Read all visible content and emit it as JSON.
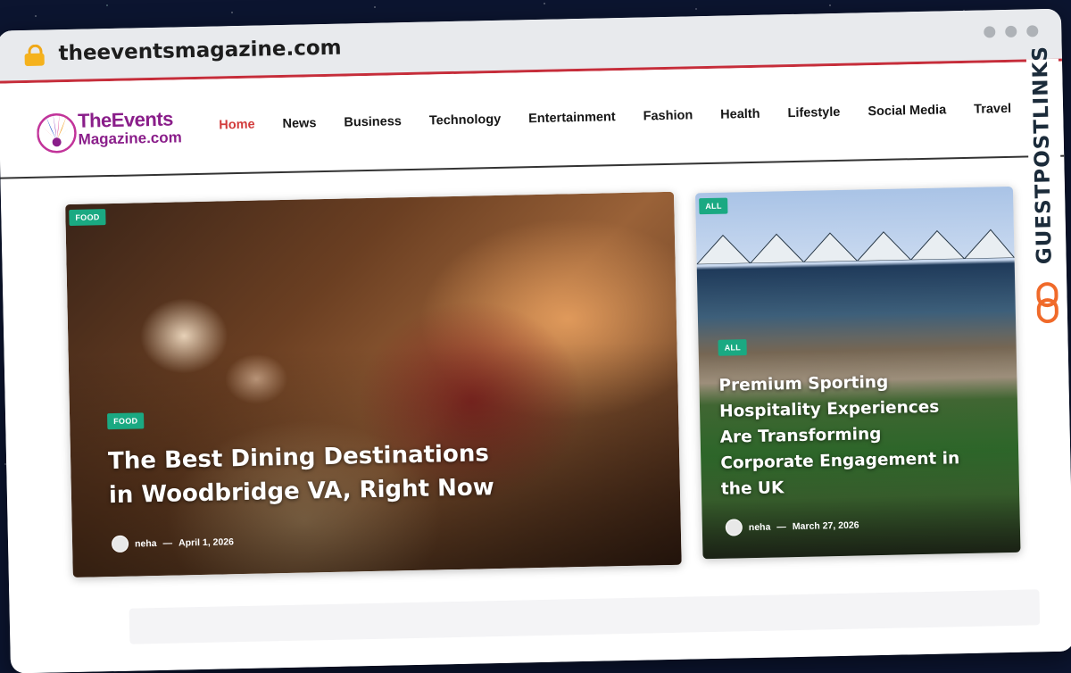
{
  "browser": {
    "url": "theeventsmagazine.com"
  },
  "logo": {
    "line1": "TheEvents",
    "line2": "Magazine.com"
  },
  "nav": [
    {
      "label": "Home",
      "active": true
    },
    {
      "label": "News"
    },
    {
      "label": "Business"
    },
    {
      "label": "Technology"
    },
    {
      "label": "Entertainment"
    },
    {
      "label": "Fashion"
    },
    {
      "label": "Health"
    },
    {
      "label": "Lifestyle"
    },
    {
      "label": "Social Media"
    },
    {
      "label": "Travel"
    }
  ],
  "featured": {
    "tag_top": "FOOD",
    "tag": "FOOD",
    "title": "The Best Dining Destinations in Woodbridge VA, Right Now",
    "author": "neha",
    "date": "April 1, 2026"
  },
  "secondary": {
    "tag_top": "ALL",
    "tag": "ALL",
    "title": "Premium Sporting Hospitality Experiences Are Transforming Corporate Engagement in the UK",
    "author": "neha",
    "date": "March 27, 2026"
  },
  "watermark": {
    "text": "GUESTPOSTLINKS"
  },
  "colors": {
    "accent": "#d23b3b",
    "tag": "#1aa982",
    "logo": "#8a1e8a",
    "chrome_rule": "#c62d3a"
  }
}
